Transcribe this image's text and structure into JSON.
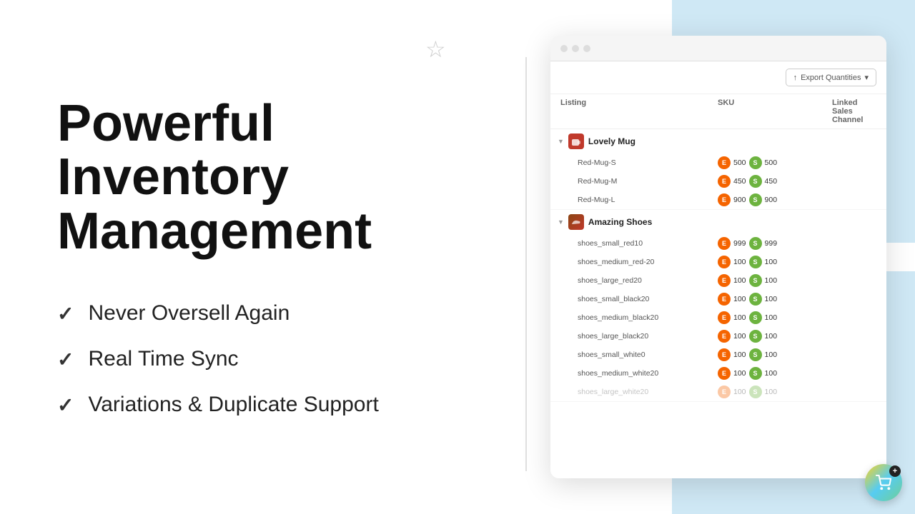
{
  "background": {
    "color_left": "#ffffff",
    "color_right_accent": "#cfe8f5"
  },
  "left": {
    "hero_line1": "Powerful Inventory",
    "hero_line2": "Management",
    "features": [
      {
        "id": "oversell",
        "text": "Never Oversell Again"
      },
      {
        "id": "sync",
        "text": "Real Time Sync"
      },
      {
        "id": "variations",
        "text": "Variations & Duplicate Support"
      }
    ]
  },
  "browser": {
    "export_btn": "Export Quantities",
    "table_headers": {
      "listing": "Listing",
      "sku": "SKU",
      "linked_sales": "Linked Sales Channel"
    },
    "products": [
      {
        "id": "lovely-mug",
        "name": "Lovely Mug",
        "icon_type": "mug",
        "skus": [
          {
            "sku": "Red-Mug-S",
            "etsy_qty": 500,
            "shopify_qty": 500
          },
          {
            "sku": "Red-Mug-M",
            "etsy_qty": 450,
            "shopify_qty": 450
          },
          {
            "sku": "Red-Mug-L",
            "etsy_qty": 900,
            "shopify_qty": 900
          }
        ]
      },
      {
        "id": "amazing-shoes",
        "name": "Amazing Shoes",
        "icon_type": "shoe",
        "skus": [
          {
            "sku": "shoes_small_red10",
            "etsy_qty": 999,
            "shopify_qty": 999
          },
          {
            "sku": "shoes_medium_red-20",
            "etsy_qty": 100,
            "shopify_qty": 100
          },
          {
            "sku": "shoes_large_red20",
            "etsy_qty": 100,
            "shopify_qty": 100
          },
          {
            "sku": "shoes_small_black20",
            "etsy_qty": 100,
            "shopify_qty": 100
          },
          {
            "sku": "shoes_medium_black20",
            "etsy_qty": 100,
            "shopify_qty": 100
          },
          {
            "sku": "shoes_large_black20",
            "etsy_qty": 100,
            "shopify_qty": 100
          },
          {
            "sku": "shoes_small_white0",
            "etsy_qty": 100,
            "shopify_qty": 100
          },
          {
            "sku": "shoes_medium_white20",
            "etsy_qty": 100,
            "shopify_qty": 100
          },
          {
            "sku": "shoes_large_white20",
            "etsy_qty": 100,
            "shopify_qty": 100,
            "faded": true
          }
        ]
      }
    ]
  },
  "cart": {
    "plus_label": "+"
  }
}
